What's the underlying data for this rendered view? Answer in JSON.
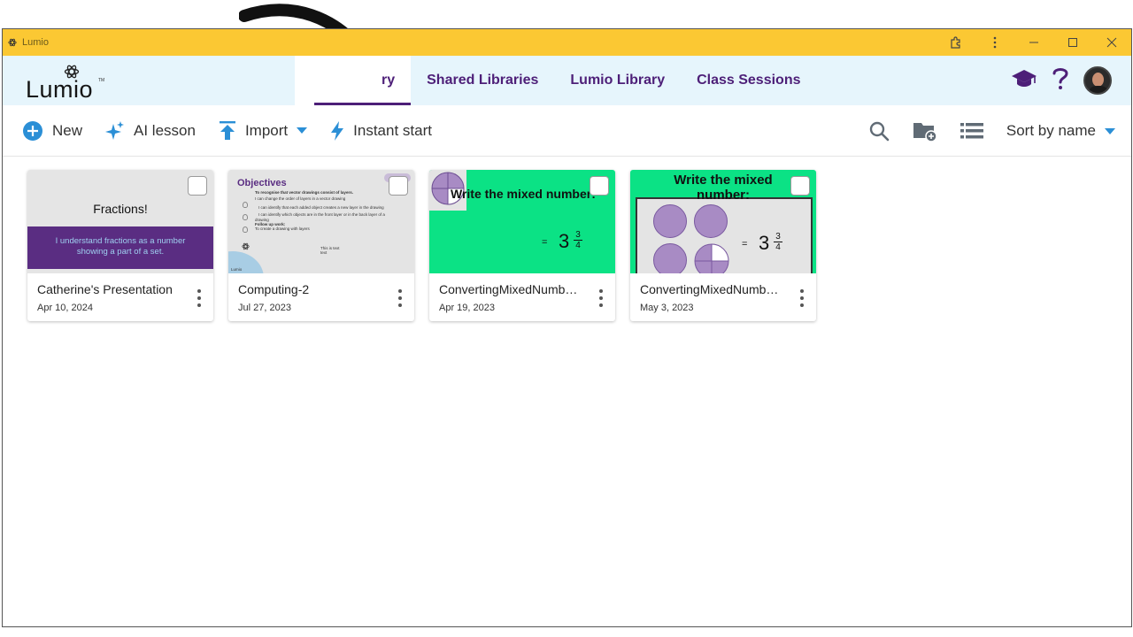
{
  "window": {
    "title": "Lumio",
    "controls": [
      "extensions-icon",
      "more-icon",
      "minimize-icon",
      "maximize-icon",
      "close-icon"
    ]
  },
  "header": {
    "logo_text": "Lumio",
    "logo_tm": "TM",
    "tabs": [
      {
        "label": "ry",
        "active": true
      },
      {
        "label": "Shared Libraries",
        "active": false
      },
      {
        "label": "Lumio Library",
        "active": false
      },
      {
        "label": "Class Sessions",
        "active": false
      }
    ],
    "right_icons": [
      "graduation-cap-icon",
      "help-icon",
      "avatar"
    ]
  },
  "toolbar": {
    "new_label": "New",
    "ai_label": "AI lesson",
    "import_label": "Import",
    "instant_label": "Instant start",
    "sort_label": "Sort by name"
  },
  "colors": {
    "titlebar": "#fbc833",
    "header_bg": "#e6f5fc",
    "brand_purple": "#4d1f78",
    "accent_blue": "#2b8fd6",
    "card_green": "#0be285"
  },
  "cards": [
    {
      "name": "Catherine's Presentation",
      "date": "Apr 10, 2024",
      "thumb_title": "Fractions!",
      "thumb_text_1": "I understand fractions as a number",
      "thumb_text_2": "showing a part of a set."
    },
    {
      "name": "Computing-2",
      "date": "Jul 27, 2023",
      "thumb_title": "Objectives",
      "lines": [
        "To recognise that vector drawings consist of layers.",
        "I can change the order of layers in a vector drawing",
        "I can identify that each added object creates a new layer in the drawing",
        "I can identify which objects are in the front layer or in the back layer of a",
        "drawing",
        "Follow up work:",
        "To create a drawing with layers"
      ],
      "small_1": "This is text",
      "small_2": "text",
      "footer_logo": "Lumio"
    },
    {
      "name": "ConvertingMixedNumb…",
      "date": "Apr 19, 2023",
      "thumb_title": "Write the mixed number:",
      "eq": "=",
      "whole": "3",
      "num": "3",
      "den": "4"
    },
    {
      "name": "ConvertingMixedNumb…",
      "date": "May 3, 2023",
      "thumb_title_1": "Write the mixed",
      "thumb_title_2": "number:",
      "eq": "=",
      "whole": "3",
      "num": "3",
      "den": "4"
    }
  ]
}
